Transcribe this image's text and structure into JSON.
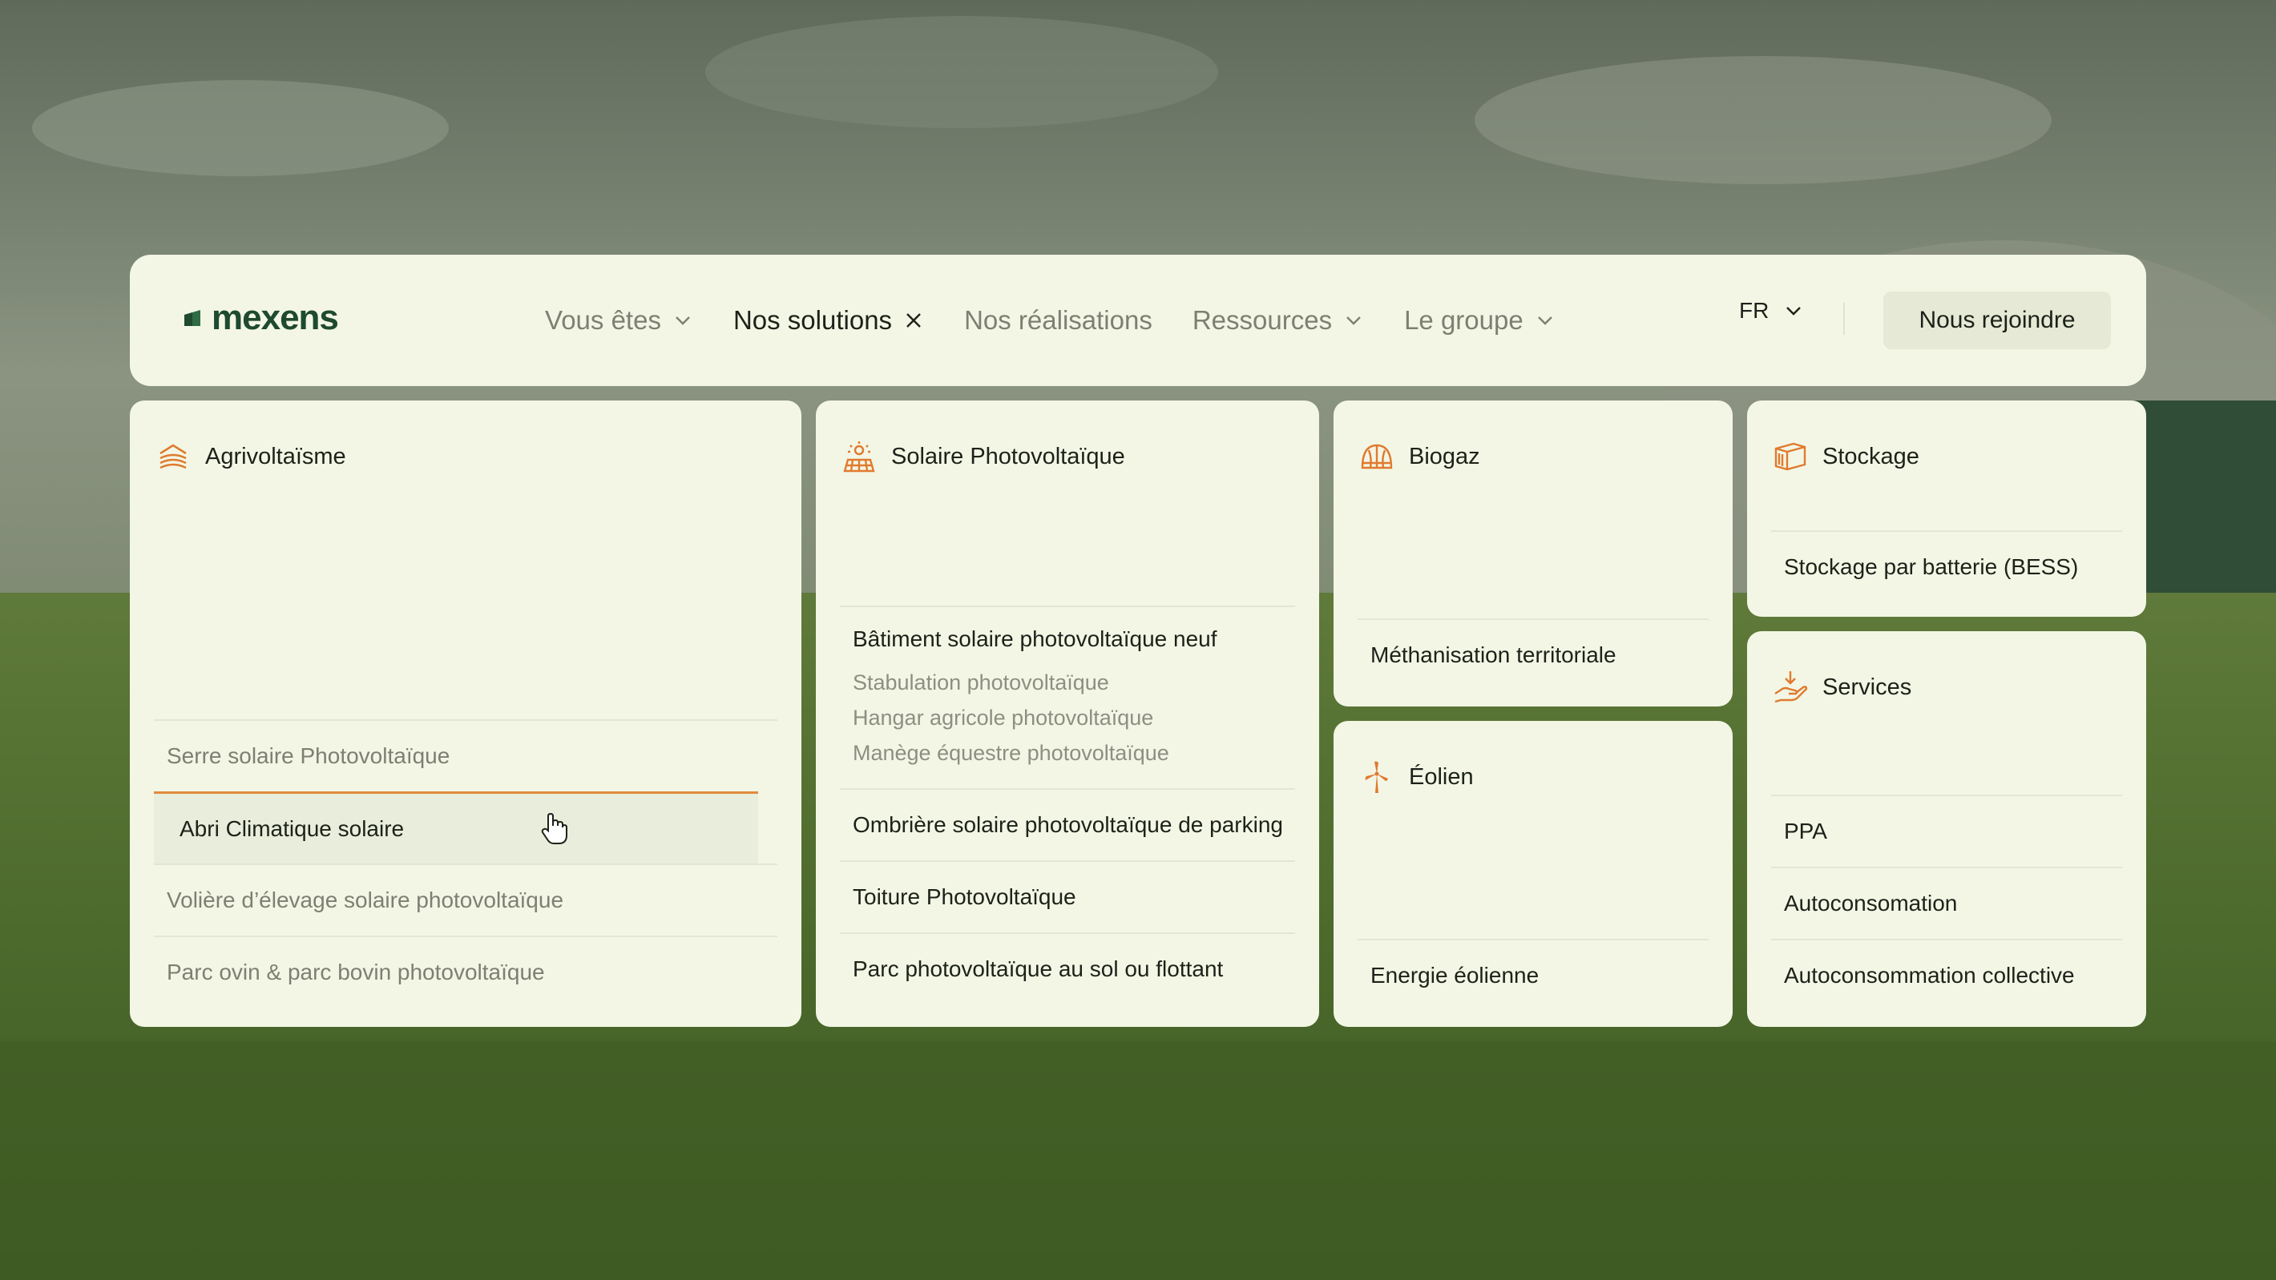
{
  "brand": {
    "name": "mexens"
  },
  "nav": {
    "items": [
      {
        "label": "Vous êtes",
        "icon": "chevron-down-icon",
        "active": false
      },
      {
        "label": "Nos solutions",
        "icon": "close-icon",
        "active": true
      },
      {
        "label": "Nos réalisations",
        "icon": null,
        "active": false
      },
      {
        "label": "Ressources",
        "icon": "chevron-down-icon",
        "active": false
      },
      {
        "label": "Le groupe",
        "icon": "chevron-down-icon",
        "active": false
      }
    ],
    "language": "FR",
    "join_label": "Nous rejoindre"
  },
  "solutions": {
    "agrivoltaisme": {
      "title": "Agrivoltaïsme",
      "icon": "agrivoltaic-icon",
      "items": [
        "Serre solaire Photovoltaïque",
        "Abri Climatique solaire",
        "Volière d’élevage solaire photovoltaïque",
        "Parc ovin & parc bovin photovoltaïque"
      ]
    },
    "solaire": {
      "title": "Solaire Photovoltaïque",
      "icon": "solar-panel-icon",
      "group": {
        "main": "Bâtiment solaire photovoltaïque neuf",
        "subs": [
          "Stabulation photovoltaïque",
          "Hangar agricole photovoltaïque",
          "Manège équestre photovoltaïque"
        ]
      },
      "items": [
        "Ombrière solaire photovoltaïque de parking",
        "Toiture Photovoltaïque",
        "Parc photovoltaïque au sol ou flottant"
      ]
    },
    "biogaz": {
      "title": "Biogaz",
      "icon": "biogas-dome-icon",
      "items": [
        "Méthanisation territoriale"
      ]
    },
    "eolien": {
      "title": "Éolien",
      "icon": "wind-turbine-icon",
      "items": [
        "Energie éolienne"
      ]
    },
    "stockage": {
      "title": "Stockage",
      "icon": "battery-storage-icon",
      "items": [
        "Stockage par batterie (BESS)"
      ]
    },
    "services": {
      "title": "Services",
      "icon": "hand-service-icon",
      "items": [
        "PPA",
        "Autoconsomation",
        "Autoconsommation collective"
      ]
    }
  },
  "colors": {
    "panel": "#f3f6e5",
    "accent": "#e08b3e",
    "brand_green": "#1e4a2f",
    "text": "#1c2219",
    "muted": "#7d7f72"
  }
}
